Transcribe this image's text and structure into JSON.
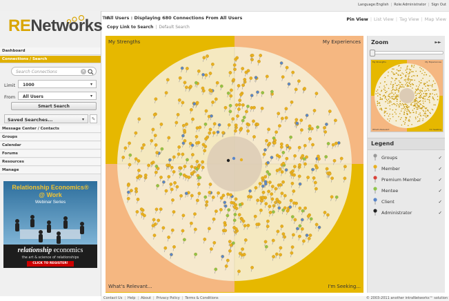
{
  "topbar": {
    "language": "Language:English",
    "role": "Role:Administrator",
    "signout": "Sign Out"
  },
  "logo": {
    "re": "RE",
    "networks": "Networks",
    "tm": "TM"
  },
  "nav": {
    "dashboard": "Dashboard",
    "connections": "Connections / Search",
    "message_center": "Message Center / Contacts",
    "groups": "Groups",
    "calendar": "Calendar",
    "forums": "Forums",
    "resources": "Resources",
    "manage": "Manage"
  },
  "search": {
    "placeholder": "Search Connections",
    "limit_label": "Limit",
    "limit_value": "1000",
    "from_label": "From",
    "from_value": "All Users",
    "smart_search": "Smart Search",
    "saved_searches": "Saved Searches..."
  },
  "ad": {
    "title_line1": "Relationship Economics®",
    "title_line2": "@ Work",
    "subtitle": "Webinar Series",
    "brand_a": "relationship",
    "brand_b": " economics",
    "tagline": "the art & science of relationships",
    "cta": "CLICK TO REGISTER!"
  },
  "main": {
    "title": "All Users : Displaying 680 Connections From All Users",
    "copy_link": "Copy Link to Search",
    "default_search": "Default Search",
    "tabs": [
      "Pin View",
      "List View",
      "Tag View",
      "Map View"
    ]
  },
  "viz": {
    "q_tl": "My Strengths",
    "q_tr": "My Experiences",
    "q_bl": "What's Relevant...",
    "q_br": "I'm Seeking...",
    "colors": {
      "yellow": "#e6b800",
      "peach": "#f5b781",
      "circle": "#f4ecd0"
    }
  },
  "zoom": {
    "title": "Zoom",
    "mini_labels": [
      "My Strengths",
      "My Experiences",
      "What's Relevant",
      "I'm Seeking"
    ]
  },
  "legend": {
    "title": "Legend",
    "items": [
      {
        "label": "Groups",
        "color": "#999999"
      },
      {
        "label": "Member",
        "color": "#e8b020"
      },
      {
        "label": "Premium Member",
        "color": "#d9423a"
      },
      {
        "label": "Mentee",
        "color": "#8fc44a"
      },
      {
        "label": "Client",
        "color": "#5a86c9"
      },
      {
        "label": "Administrator",
        "color": "#222222"
      }
    ],
    "check": "✓"
  },
  "footer": {
    "links": [
      "Contact Us",
      "Help",
      "About",
      "Privacy Policy",
      "Terms & Conditions"
    ],
    "copyright": "© 2003-2011 another intraNetworks™ solution"
  }
}
